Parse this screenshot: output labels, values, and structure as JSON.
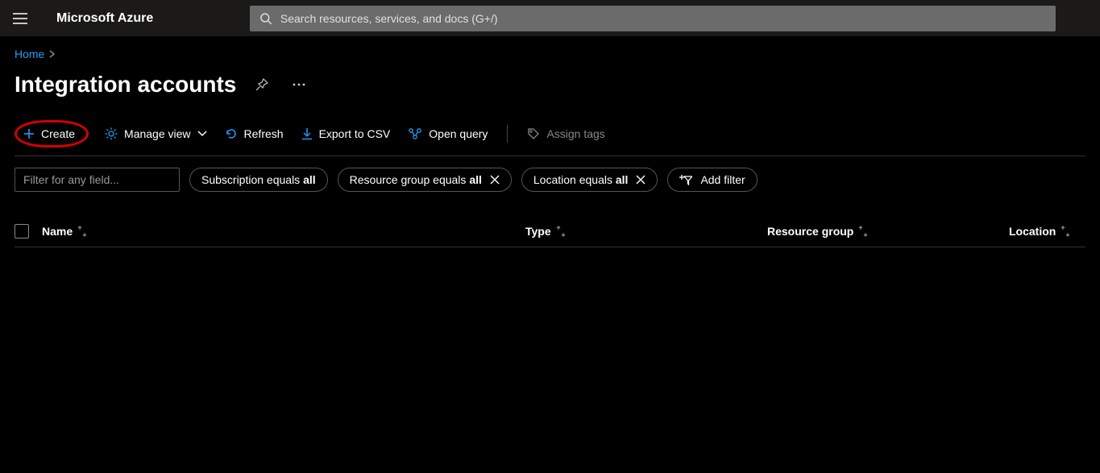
{
  "header": {
    "brand": "Microsoft Azure",
    "search_placeholder": "Search resources, services, and docs (G+/)"
  },
  "breadcrumb": {
    "home": "Home"
  },
  "page": {
    "title": "Integration accounts"
  },
  "toolbar": {
    "create": "Create",
    "manage_view": "Manage view",
    "refresh": "Refresh",
    "export_csv": "Export to CSV",
    "open_query": "Open query",
    "assign_tags": "Assign tags"
  },
  "filters": {
    "filter_placeholder": "Filter for any field...",
    "subscription_prefix": "Subscription equals ",
    "subscription_value": "all",
    "resource_group_prefix": "Resource group equals ",
    "resource_group_value": "all",
    "location_prefix": "Location equals ",
    "location_value": "all",
    "add_filter": "Add filter"
  },
  "columns": {
    "name": "Name",
    "type": "Type",
    "resource_group": "Resource group",
    "location": "Location"
  }
}
